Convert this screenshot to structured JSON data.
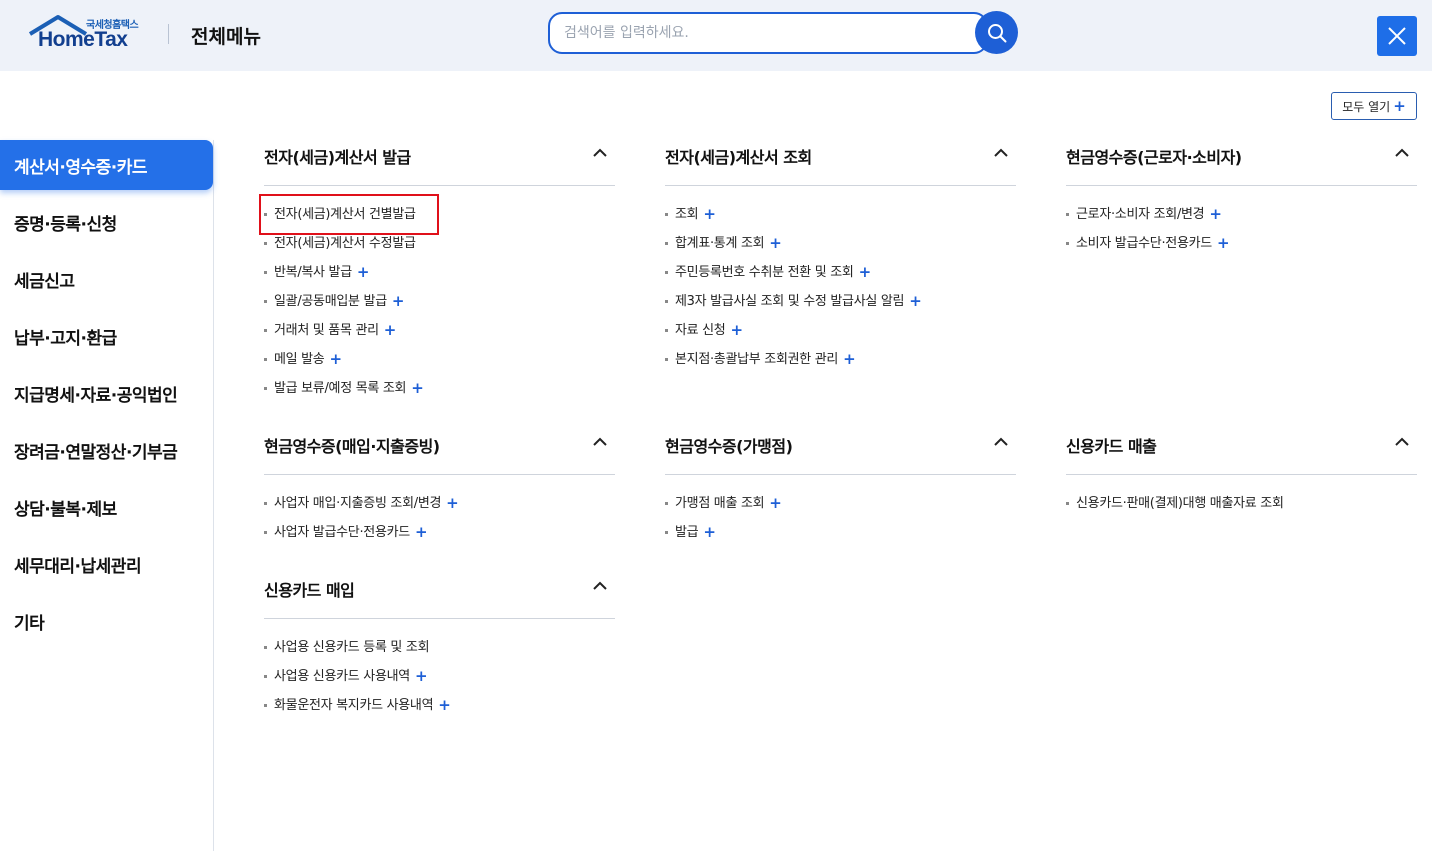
{
  "header": {
    "logo_sub": "국세청홈택스",
    "logo_main": "HomeTax",
    "title": "전체메뉴",
    "search_placeholder": "검색어를 입력하세요.",
    "search_icon": "search-icon",
    "close_icon": "close-icon"
  },
  "expand_all": {
    "label": "모두 열기",
    "plus": "+"
  },
  "sidebar": {
    "items": [
      {
        "label": "계산서·영수증·카드",
        "active": true
      },
      {
        "label": "증명·등록·신청"
      },
      {
        "label": "세금신고"
      },
      {
        "label": "납부·고지·환급"
      },
      {
        "label": "지급명세·자료·공익법인"
      },
      {
        "label": "장려금·연말정산·기부금"
      },
      {
        "label": "상담·불복·제보"
      },
      {
        "label": "세무대리·납세관리"
      },
      {
        "label": "기타"
      }
    ]
  },
  "sections": [
    {
      "title": "전자(세금)계산서 발급",
      "items": [
        {
          "label": "전자(세금)계산서 건별발급",
          "plus": ""
        },
        {
          "label": "전자(세금)계산서 수정발급",
          "plus": ""
        },
        {
          "label": "반복/복사 발급",
          "plus": "+"
        },
        {
          "label": "일괄/공동매입분 발급",
          "plus": "+"
        },
        {
          "label": "거래처 및 품목 관리",
          "plus": "+"
        },
        {
          "label": "메일 발송",
          "plus": "+"
        },
        {
          "label": "발급 보류/예정 목록 조회",
          "plus": "+"
        }
      ]
    },
    {
      "title": "전자(세금)계산서 조회",
      "items": [
        {
          "label": "조회",
          "plus": "+"
        },
        {
          "label": "합계표·통계 조회",
          "plus": "+"
        },
        {
          "label": "주민등록번호 수취분 전환 및 조회",
          "plus": "+"
        },
        {
          "label": "제3자 발급사실 조회 및 수정 발급사실 알림",
          "plus": "+"
        },
        {
          "label": "자료 신청",
          "plus": "+"
        },
        {
          "label": "본지점·총괄납부 조회권한 관리",
          "plus": "+"
        }
      ]
    },
    {
      "title": "현금영수증(근로자·소비자)",
      "items": [
        {
          "label": "근로자·소비자 조회/변경",
          "plus": "+"
        },
        {
          "label": "소비자 발급수단·전용카드",
          "plus": "+"
        }
      ]
    },
    {
      "title": "현금영수증(매입·지출증빙)",
      "items": [
        {
          "label": "사업자 매입·지출증빙 조회/변경",
          "plus": "+"
        },
        {
          "label": "사업자 발급수단·전용카드",
          "plus": "+"
        }
      ]
    },
    {
      "title": "현금영수증(가맹점)",
      "items": [
        {
          "label": "가맹점 매출 조회",
          "plus": "+"
        },
        {
          "label": "발급",
          "plus": "+"
        }
      ]
    },
    {
      "title": "신용카드 매출",
      "items": [
        {
          "label": "신용카드·판매(결제)대행 매출자료 조회",
          "plus": ""
        }
      ]
    },
    {
      "title": "신용카드 매입",
      "items": [
        {
          "label": "사업용 신용카드 등록 및 조회",
          "plus": ""
        },
        {
          "label": "사업용 신용카드 사용내역",
          "plus": "+"
        },
        {
          "label": "화물운전자 복지카드 사용내역",
          "plus": "+"
        }
      ]
    }
  ],
  "colors": {
    "accent": "#2470e8",
    "brand": "#123f8f",
    "highlight": "#e0101a"
  }
}
